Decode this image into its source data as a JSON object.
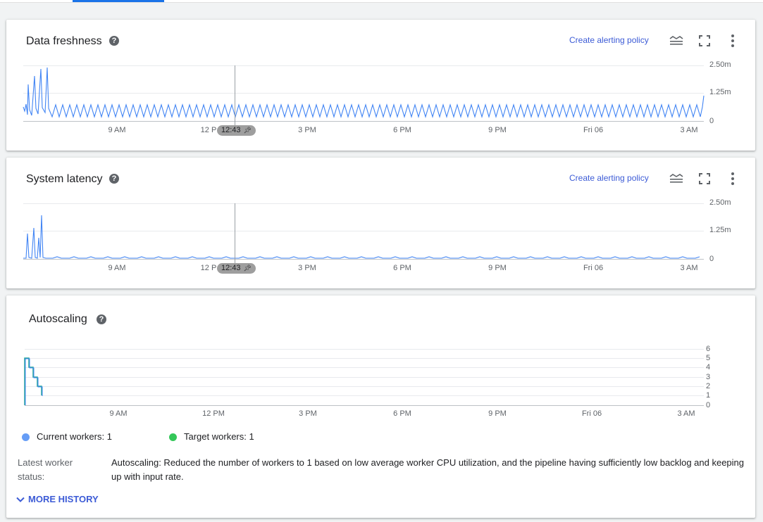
{
  "cards": [
    {
      "title": "Data freshness",
      "help_icon": "help-circle-icon",
      "alert_link": "Create alerting policy",
      "tools": [
        "legend-toggle-icon",
        "fullscreen-icon",
        "more-vert-icon"
      ],
      "y_ticks": [
        "2.50m",
        "1.25m",
        "0"
      ],
      "x_ticks": [
        "9 AM",
        "12 P",
        "3 PM",
        "6 PM",
        "9 PM",
        "Fri 06",
        "3 AM"
      ],
      "cursor_label": "12:43",
      "cursor_icon": "pin-icon"
    },
    {
      "title": "System latency",
      "help_icon": "help-circle-icon",
      "alert_link": "Create alerting policy",
      "tools": [
        "legend-toggle-icon",
        "fullscreen-icon",
        "more-vert-icon"
      ],
      "y_ticks": [
        "2.50m",
        "1.25m",
        "0"
      ],
      "x_ticks": [
        "9 AM",
        "12 P",
        "3 PM",
        "6 PM",
        "9 PM",
        "Fri 06",
        "3 AM"
      ],
      "cursor_label": "12:43",
      "cursor_icon": "pin-icon"
    }
  ],
  "autoscaling": {
    "title": "Autoscaling",
    "help_icon": "help-circle-icon",
    "y_ticks": [
      "6",
      "5",
      "4",
      "3",
      "2",
      "1",
      "0"
    ],
    "x_ticks": [
      "9 AM",
      "12 PM",
      "3 PM",
      "6 PM",
      "9 PM",
      "Fri 06",
      "3 AM"
    ],
    "legend": [
      {
        "label": "Current workers:",
        "value": "1",
        "color": "#669df6"
      },
      {
        "label": "Target workers:",
        "value": "1",
        "color": "#34c759"
      }
    ],
    "status_label": "Latest worker status:",
    "status_text": "Autoscaling: Reduced the number of workers to 1 based on low average worker CPU utilization, and the pipeline having sufficiently low backlog and keeping up with input rate.",
    "more_history": "MORE HISTORY",
    "more_icon": "chevron-down-icon"
  },
  "colors": {
    "series_blue": "#4285f4",
    "series_teal": "#26a69a",
    "link": "#3c5bd6"
  }
}
